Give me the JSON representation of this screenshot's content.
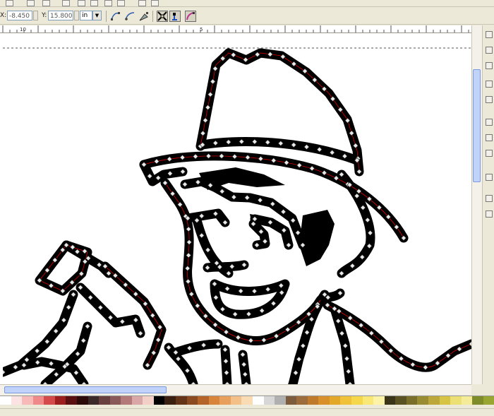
{
  "toolbar": {
    "x_label": "X:",
    "x_value": "-8.450",
    "y_label": "Y:",
    "y_value": "15.800",
    "unit": "in",
    "buttons": [
      {
        "name": "node-curve-tool-button"
      },
      {
        "name": "node-smooth-tool-button"
      },
      {
        "name": "node-edit-tool-button"
      },
      {
        "name": "transform-handles-button",
        "active": true
      },
      {
        "name": "show-nodes-button",
        "active": true
      },
      {
        "name": "show-path-outline-button",
        "active": true
      }
    ]
  },
  "ruler": {
    "tick_labels": [
      "10",
      "5"
    ]
  },
  "palette": {
    "colors": [
      "#ffffff",
      "#fce3e3",
      "#f8b9b9",
      "#f08a8a",
      "#d44a4a",
      "#9c1e1e",
      "#5a1010",
      "#2c0a0a",
      "#3c2a2a",
      "#684040",
      "#8a5a5a",
      "#b47a7a",
      "#d9a7a7",
      "#f2d0c8",
      "#000000",
      "#3a2010",
      "#643418",
      "#8c4a20",
      "#b46428",
      "#d8843a",
      "#e9a05c",
      "#f3c08a",
      "#f9dcb4",
      "#ffffff",
      "#d7d7d7",
      "#b0b0b0",
      "#7c5c3c",
      "#9c6c3c",
      "#c07a2c",
      "#d9902a",
      "#e3a82a",
      "#efc23a",
      "#f5d84a",
      "#f9e876",
      "#fdf3a8",
      "#3a3418",
      "#5a5222",
      "#7a6f2a",
      "#9a8c32",
      "#bca83a",
      "#d8c444",
      "#ece074",
      "#f4ec98",
      "#7e8c2a",
      "#9aa632"
    ]
  }
}
